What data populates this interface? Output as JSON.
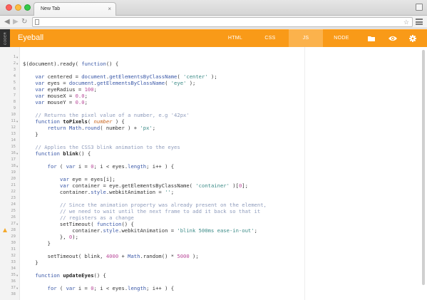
{
  "browser": {
    "tab_title": "New Tab",
    "tab_close": "×",
    "address": "",
    "icons": {
      "back": "back-arrow-icon",
      "forward": "forward-arrow-icon",
      "reload": "reload-icon",
      "star": "bookmark-star-icon",
      "menu": "hamburger-menu-icon"
    }
  },
  "app": {
    "brand": "CODER",
    "title": "Eyeball",
    "tabs": [
      {
        "label": "HTML",
        "active": false
      },
      {
        "label": "CSS",
        "active": false
      },
      {
        "label": "JS",
        "active": true
      },
      {
        "label": "NODE",
        "active": false
      }
    ],
    "icons": {
      "folder": "folder-icon",
      "preview": "eye-icon",
      "settings": "gear-icon"
    },
    "colors": {
      "header": "#f99a18",
      "active_tab": "#fbb24c"
    }
  },
  "editor": {
    "lines": [
      {
        "n": "1",
        "fold": true,
        "warn": false,
        "tokens": []
      },
      {
        "n": "2",
        "fold": true,
        "warn": false,
        "tokens": [
          [
            "plain",
            "$(document).ready( "
          ],
          [
            "kw",
            "function"
          ],
          [
            "plain",
            "() {"
          ]
        ]
      },
      {
        "n": "3",
        "fold": false,
        "warn": false,
        "tokens": []
      },
      {
        "n": "4",
        "fold": false,
        "warn": false,
        "tokens": [
          [
            "plain",
            "    "
          ],
          [
            "kw",
            "var"
          ],
          [
            "plain",
            " centered = "
          ],
          [
            "prop",
            "document"
          ],
          [
            "plain",
            "."
          ],
          [
            "prop",
            "getElementsByClassName"
          ],
          [
            "plain",
            "( "
          ],
          [
            "str",
            "'center'"
          ],
          [
            "plain",
            " );"
          ]
        ]
      },
      {
        "n": "5",
        "fold": false,
        "warn": false,
        "tokens": [
          [
            "plain",
            "    "
          ],
          [
            "kw",
            "var"
          ],
          [
            "plain",
            " eyes = "
          ],
          [
            "prop",
            "document"
          ],
          [
            "plain",
            "."
          ],
          [
            "prop",
            "getElementsByClassName"
          ],
          [
            "plain",
            "( "
          ],
          [
            "str",
            "'eye'"
          ],
          [
            "plain",
            " );"
          ]
        ]
      },
      {
        "n": "6",
        "fold": false,
        "warn": false,
        "tokens": [
          [
            "plain",
            "    "
          ],
          [
            "kw",
            "var"
          ],
          [
            "plain",
            " eyeRadius = "
          ],
          [
            "num",
            "100"
          ],
          [
            "plain",
            ";"
          ]
        ]
      },
      {
        "n": "7",
        "fold": false,
        "warn": false,
        "tokens": [
          [
            "plain",
            "    "
          ],
          [
            "kw",
            "var"
          ],
          [
            "plain",
            " mouseX = "
          ],
          [
            "num",
            "0.0"
          ],
          [
            "plain",
            ";"
          ]
        ]
      },
      {
        "n": "8",
        "fold": false,
        "warn": false,
        "tokens": [
          [
            "plain",
            "    "
          ],
          [
            "kw",
            "var"
          ],
          [
            "plain",
            " mouseY = "
          ],
          [
            "num",
            "0.0"
          ],
          [
            "plain",
            ";"
          ]
        ]
      },
      {
        "n": "9",
        "fold": false,
        "warn": false,
        "tokens": []
      },
      {
        "n": "10",
        "fold": false,
        "warn": false,
        "tokens": [
          [
            "plain",
            "    "
          ],
          [
            "com",
            "// Returns the pixel value of a number, e.g '42px'"
          ]
        ]
      },
      {
        "n": "11",
        "fold": true,
        "warn": false,
        "tokens": [
          [
            "plain",
            "    "
          ],
          [
            "kw",
            "function"
          ],
          [
            "plain",
            " "
          ],
          [
            "fn",
            "toPixels"
          ],
          [
            "plain",
            "( "
          ],
          [
            "param",
            "number"
          ],
          [
            "plain",
            " ) {"
          ]
        ]
      },
      {
        "n": "12",
        "fold": false,
        "warn": false,
        "tokens": [
          [
            "plain",
            "        "
          ],
          [
            "kw",
            "return"
          ],
          [
            "plain",
            " "
          ],
          [
            "prop",
            "Math"
          ],
          [
            "plain",
            "."
          ],
          [
            "prop",
            "round"
          ],
          [
            "plain",
            "( number ) + "
          ],
          [
            "str",
            "'px'"
          ],
          [
            "plain",
            ";"
          ]
        ]
      },
      {
        "n": "13",
        "fold": false,
        "warn": false,
        "tokens": [
          [
            "plain",
            "    }"
          ]
        ]
      },
      {
        "n": "14",
        "fold": false,
        "warn": false,
        "tokens": []
      },
      {
        "n": "15",
        "fold": false,
        "warn": false,
        "tokens": [
          [
            "plain",
            "    "
          ],
          [
            "com",
            "// Applies the CSS3 blink animation to the eyes"
          ]
        ]
      },
      {
        "n": "16",
        "fold": true,
        "warn": false,
        "tokens": [
          [
            "plain",
            "    "
          ],
          [
            "kw",
            "function"
          ],
          [
            "plain",
            " "
          ],
          [
            "fn",
            "blink"
          ],
          [
            "plain",
            "() {"
          ]
        ]
      },
      {
        "n": "17",
        "fold": false,
        "warn": false,
        "tokens": []
      },
      {
        "n": "18",
        "fold": true,
        "warn": false,
        "tokens": [
          [
            "plain",
            "        "
          ],
          [
            "kw",
            "for"
          ],
          [
            "plain",
            " ( "
          ],
          [
            "kw",
            "var"
          ],
          [
            "plain",
            " i = "
          ],
          [
            "num",
            "0"
          ],
          [
            "plain",
            "; i < eyes."
          ],
          [
            "prop",
            "length"
          ],
          [
            "plain",
            "; i++ ) {"
          ]
        ]
      },
      {
        "n": "19",
        "fold": false,
        "warn": false,
        "tokens": []
      },
      {
        "n": "20",
        "fold": false,
        "warn": false,
        "tokens": [
          [
            "plain",
            "            "
          ],
          [
            "kw",
            "var"
          ],
          [
            "plain",
            " eye = eyes[i];"
          ]
        ]
      },
      {
        "n": "21",
        "fold": false,
        "warn": false,
        "tokens": [
          [
            "plain",
            "            "
          ],
          [
            "kw",
            "var"
          ],
          [
            "plain",
            " container = eye.getElementsByClassName( "
          ],
          [
            "str",
            "'container'"
          ],
          [
            "plain",
            " )["
          ],
          [
            "num",
            "0"
          ],
          [
            "plain",
            "];"
          ]
        ]
      },
      {
        "n": "22",
        "fold": false,
        "warn": false,
        "tokens": [
          [
            "plain",
            "            container."
          ],
          [
            "prop",
            "style"
          ],
          [
            "plain",
            ".webkitAnimation = "
          ],
          [
            "str",
            "''"
          ],
          [
            "plain",
            ";"
          ]
        ]
      },
      {
        "n": "23",
        "fold": false,
        "warn": false,
        "tokens": []
      },
      {
        "n": "24",
        "fold": false,
        "warn": false,
        "tokens": [
          [
            "plain",
            "            "
          ],
          [
            "com",
            "// Since the animation property was already present on the element,"
          ]
        ]
      },
      {
        "n": "25",
        "fold": false,
        "warn": false,
        "tokens": [
          [
            "plain",
            "            "
          ],
          [
            "com",
            "// we need to wait until the next frame to add it back so that it"
          ]
        ]
      },
      {
        "n": "26",
        "fold": false,
        "warn": false,
        "tokens": [
          [
            "plain",
            "            "
          ],
          [
            "com",
            "// registers as a change"
          ]
        ]
      },
      {
        "n": "27",
        "fold": true,
        "warn": false,
        "tokens": [
          [
            "plain",
            "            setTimeout( "
          ],
          [
            "kw",
            "function"
          ],
          [
            "plain",
            "() {"
          ]
        ]
      },
      {
        "n": "28",
        "fold": false,
        "warn": true,
        "tokens": [
          [
            "plain",
            "                container."
          ],
          [
            "prop",
            "style"
          ],
          [
            "plain",
            ".webkitAnimation = "
          ],
          [
            "str",
            "'blink 500ms ease-in-out'"
          ],
          [
            "plain",
            ";"
          ]
        ]
      },
      {
        "n": "29",
        "fold": false,
        "warn": false,
        "tokens": [
          [
            "plain",
            "            }, "
          ],
          [
            "num",
            "0"
          ],
          [
            "plain",
            ");"
          ]
        ]
      },
      {
        "n": "30",
        "fold": false,
        "warn": false,
        "tokens": [
          [
            "plain",
            "        }"
          ]
        ]
      },
      {
        "n": "31",
        "fold": false,
        "warn": false,
        "tokens": []
      },
      {
        "n": "32",
        "fold": false,
        "warn": false,
        "tokens": [
          [
            "plain",
            "        setTimeout( blink, "
          ],
          [
            "num",
            "4000"
          ],
          [
            "plain",
            " + "
          ],
          [
            "prop",
            "Math"
          ],
          [
            "plain",
            ".random() * "
          ],
          [
            "num",
            "5000"
          ],
          [
            "plain",
            " );"
          ]
        ]
      },
      {
        "n": "33",
        "fold": false,
        "warn": false,
        "tokens": [
          [
            "plain",
            "    }"
          ]
        ]
      },
      {
        "n": "34",
        "fold": false,
        "warn": false,
        "tokens": []
      },
      {
        "n": "35",
        "fold": true,
        "warn": false,
        "tokens": [
          [
            "plain",
            "    "
          ],
          [
            "kw",
            "function"
          ],
          [
            "plain",
            " "
          ],
          [
            "fn",
            "updateEyes"
          ],
          [
            "plain",
            "() {"
          ]
        ]
      },
      {
        "n": "36",
        "fold": false,
        "warn": false,
        "tokens": []
      },
      {
        "n": "37",
        "fold": true,
        "warn": false,
        "tokens": [
          [
            "plain",
            "        "
          ],
          [
            "kw",
            "for"
          ],
          [
            "plain",
            " ( "
          ],
          [
            "kw",
            "var"
          ],
          [
            "plain",
            " i = "
          ],
          [
            "num",
            "0"
          ],
          [
            "plain",
            "; i < eyes."
          ],
          [
            "prop",
            "length"
          ],
          [
            "plain",
            "; i++ ) {"
          ]
        ]
      },
      {
        "n": "38",
        "fold": false,
        "warn": false,
        "tokens": []
      }
    ]
  }
}
